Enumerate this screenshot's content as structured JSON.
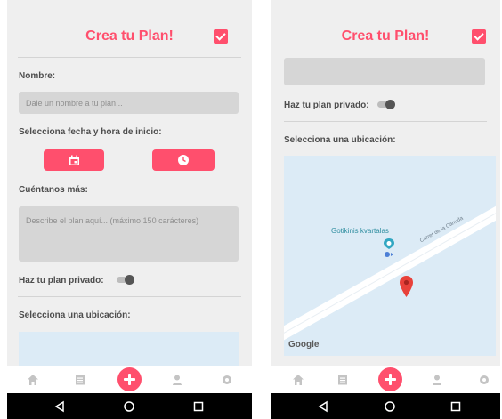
{
  "screen1": {
    "title": "Crea tu Plan!",
    "name_label": "Nombre:",
    "name_placeholder": "Dale un nombre a tu plan...",
    "datetime_label": "Selecciona fecha y hora de inicio:",
    "more_label": "Cuéntanos más:",
    "description_placeholder": "Describe el plan aquí... (máximo 150 carácteres)",
    "private_label": "Haz tu plan privado:",
    "private_enabled": false,
    "location_label": "Selecciona una ubicación:"
  },
  "screen2": {
    "title": "Crea tu Plan!",
    "private_label": "Haz tu plan privado:",
    "private_enabled": false,
    "location_label": "Selecciona una ubicación:",
    "map": {
      "place_name": "Gotikinis kvartalas",
      "street_name": "Carrer de la Canuda",
      "google_logo": "Google"
    }
  },
  "nav": {
    "items": [
      "home-icon",
      "list-icon",
      "add-icon",
      "profile-icon",
      "settings-icon"
    ],
    "active": "add-icon"
  },
  "system_nav": [
    "back-icon",
    "home-circle-icon",
    "recents-icon"
  ],
  "colors": {
    "accent": "#ff4f6d",
    "background": "#efefef",
    "input": "#d6d6d6",
    "map_water": "#dcebf6",
    "inactive_icon": "#c4c4c4"
  }
}
